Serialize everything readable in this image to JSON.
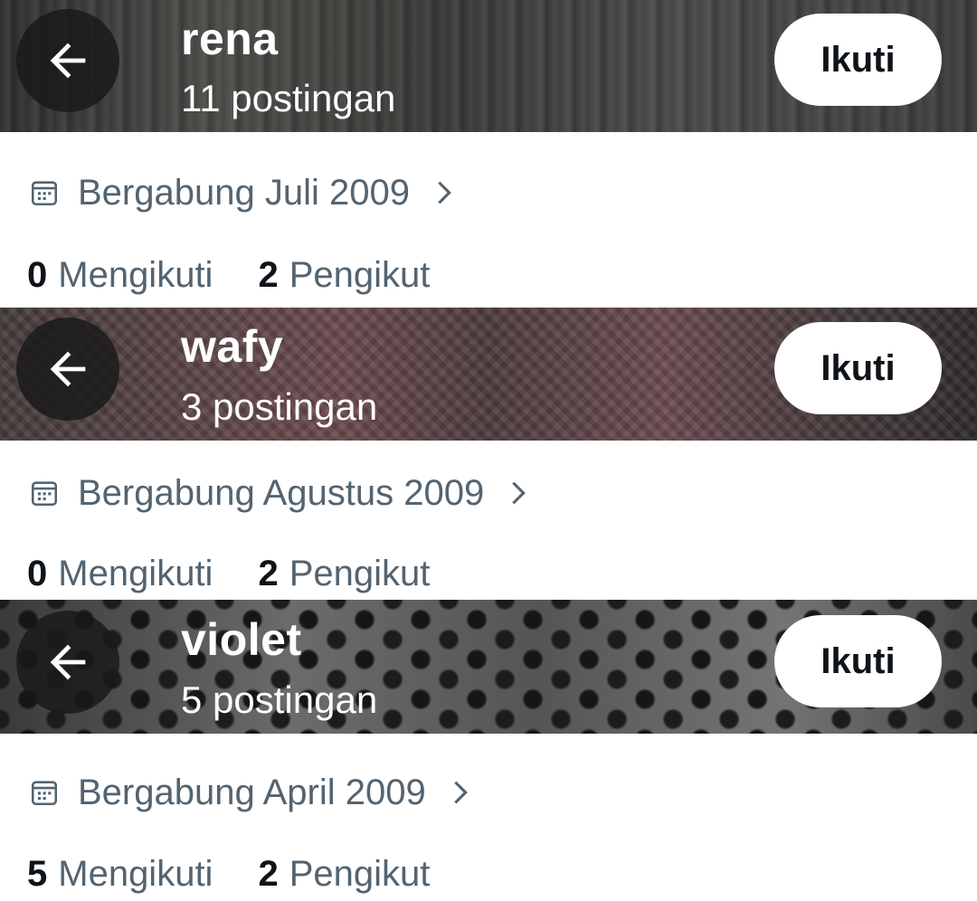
{
  "profiles": [
    {
      "name": "rena",
      "posts": "11 postingan",
      "follow_label": "Ikuti",
      "joined": "Bergabung Juli 2009",
      "following_count": "0",
      "following_label": "Mengikuti",
      "followers_count": "2",
      "followers_label": "Pengikut"
    },
    {
      "name": "wafy",
      "posts": "3 postingan",
      "follow_label": "Ikuti",
      "joined": "Bergabung Agustus 2009",
      "following_count": "0",
      "following_label": "Mengikuti",
      "followers_count": "2",
      "followers_label": "Pengikut"
    },
    {
      "name": "violet",
      "posts": "5 postingan",
      "follow_label": "Ikuti",
      "joined": "Bergabung April 2009",
      "following_count": "5",
      "following_label": "Mengikuti",
      "followers_count": "2",
      "followers_label": "Pengikut"
    }
  ],
  "icons": {
    "back": "arrow-left-icon",
    "calendar": "calendar-icon",
    "chevron": "chevron-right-icon"
  },
  "colors": {
    "text_primary": "#0f1419",
    "text_secondary": "#536471",
    "button_bg": "#ffffff"
  }
}
